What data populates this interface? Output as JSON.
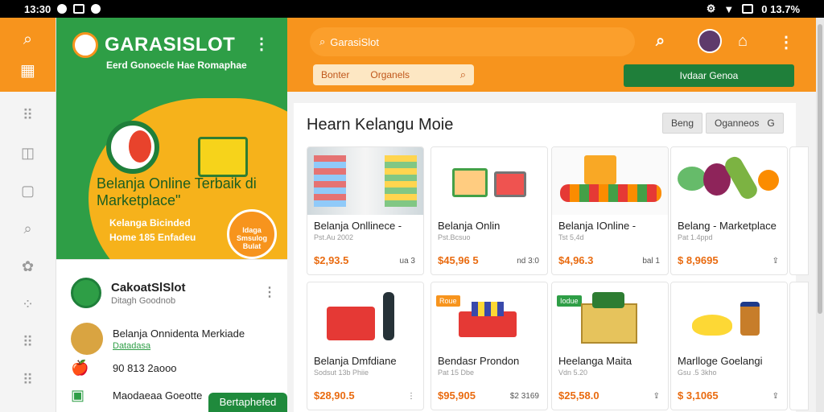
{
  "statusbar": {
    "time": "13:30",
    "battery": "0 13.7%"
  },
  "promo": {
    "brand": "GARASISLOT",
    "tagline": "Eerd Gonoecle Hae Romaphae",
    "headline": "Belanja Online Terbaik di Marketplace\"",
    "subline_1": "Kelanga Bicinded",
    "subline_2": "Home 185 Enfadeu",
    "badge": "Idaga Smsulog Bulat"
  },
  "store": {
    "name": "CakoatSlSlot",
    "subtitle": "Ditagh Goodnob",
    "row2_text": "Belanja Onnidenta Merkiade",
    "row2_link": "Datadasa",
    "row3_price": "90 813 2aooo",
    "row4_text": "Maodaeaa Goeotte",
    "follow_button": "Bertaphefed"
  },
  "header": {
    "search_text": "GarasiSlot",
    "filter_left": "Bonter",
    "filter_right": "Organels",
    "cta": "Ivdaar Genoa"
  },
  "main": {
    "title": "Hearn Kelangu Moie",
    "chip_1": "Beng",
    "chip_2": "Oganneos",
    "chip_2_icon": "G"
  },
  "products_row1": [
    {
      "title": "Belanja Onllinece -",
      "sub": "Pst.Au 2002",
      "price": "$2,93.5",
      "meta": "ua 3"
    },
    {
      "title": "Belanja Onlin",
      "sub": "Pst.Bcsuo",
      "price": "$45,96 5",
      "meta": "nd 3:0"
    },
    {
      "title": "Belanja IOnline -",
      "sub": "Tst 5,4d",
      "price": "$4,96.3",
      "meta": "bal 1"
    },
    {
      "title": "Belang - Marketplace",
      "sub": "Pat 1.4ppd",
      "price": "$ 8,9695",
      "meta": ""
    }
  ],
  "products_row2": [
    {
      "title": "Belanja Dmfdiane",
      "sub": "Sodsut 13b Phiie",
      "price": "$28,90.5",
      "meta": "",
      "tag": ""
    },
    {
      "title": "Bendasr Prondon",
      "sub": "Pat 15 Dbe",
      "price": "$95,905",
      "meta": "$2 3169",
      "tag": "Roue"
    },
    {
      "title": "Heelanga Maita",
      "sub": "Vdn 5.20",
      "price": "$25,58.0",
      "meta": "",
      "tag": "Iodue"
    },
    {
      "title": "Marlloge Goelangi",
      "sub": "Gsu .5 3kho",
      "price": "$ 3,1065",
      "meta": "",
      "tag": ""
    }
  ],
  "colors": {
    "orange": "#f7941d",
    "green": "#2e9e46",
    "dark_green": "#1f7f3a",
    "price": "#e96b10"
  }
}
